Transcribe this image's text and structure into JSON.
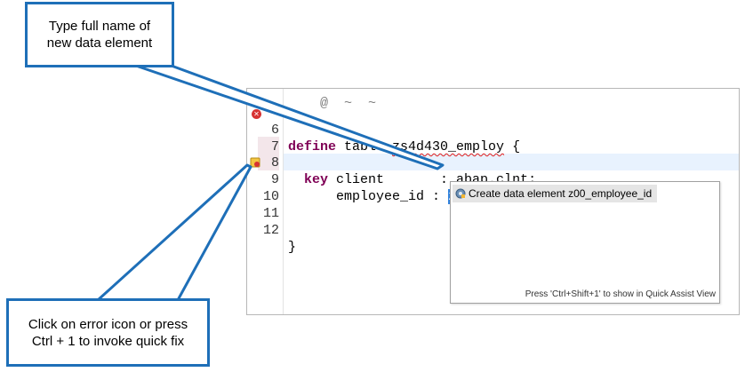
{
  "editor": {
    "lines": [
      {
        "number": "6",
        "kw": "define",
        "rest": " table ",
        "squiggle": "zs4d430_employ",
        "tail": " {"
      },
      {
        "number": "7"
      },
      {
        "number": "8",
        "kw": "key",
        "rest": " client       : abap.clnt;"
      },
      {
        "number": "9",
        "field": "employee_id : ",
        "selected": "z00_employee_id",
        "tail": ";"
      },
      {
        "number": "10"
      },
      {
        "number": "11"
      },
      {
        "number": "12",
        "rest": "}"
      }
    ]
  },
  "quick_assist": {
    "item_label": "Create data element z00_employee_id",
    "footer": "Press 'Ctrl+Shift+1' to show in Quick Assist View"
  },
  "callouts": {
    "top": "Type full name of new data element",
    "bottom": "Click on error icon or press Ctrl + 1 to invoke quick fix"
  },
  "colors": {
    "callout_border": "#1e6fb8",
    "keyword": "#7f0055",
    "selection": "#3385e0",
    "error": "#d73232"
  }
}
